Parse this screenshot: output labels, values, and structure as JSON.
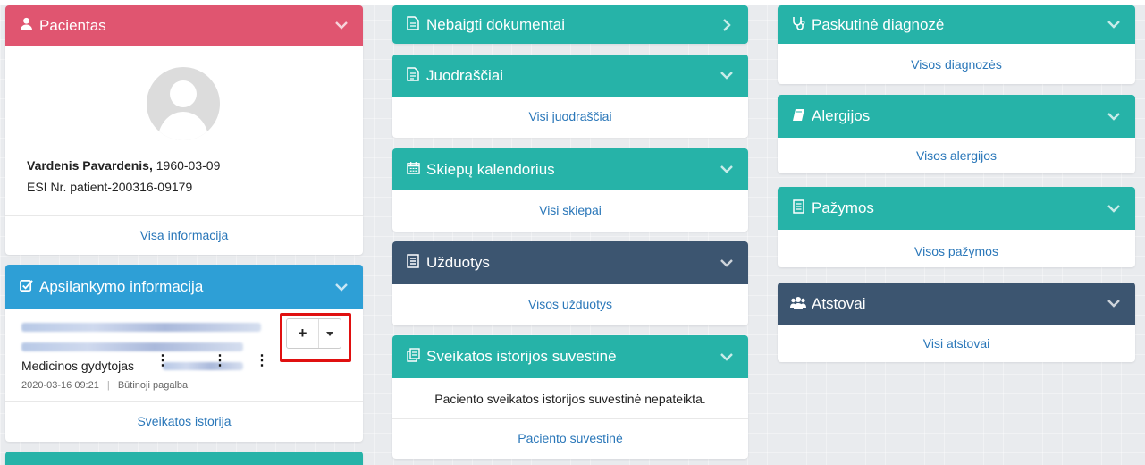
{
  "colors": {
    "teal": "#26b3a8",
    "pink": "#e05570",
    "blue": "#2e9fd6",
    "navy": "#3c5570",
    "link": "#2a77b9",
    "highlight": "#e01010"
  },
  "patient": {
    "title": "Pacientas",
    "icon": "user-icon",
    "name": "Vardenis Pavardenis,",
    "birth_date": "1960-03-09",
    "esi": "ESI Nr. patient-200316-09179",
    "link": "Visa informacija"
  },
  "visit": {
    "title": "Apsilankymo informacija",
    "icon": "checkbox-icon",
    "doctor_label": "Medicinos gydytojas",
    "date": "2020-03-16 09:21",
    "separator": "|",
    "type": "Būtinoji pagalba",
    "add_button": "+",
    "link": "Sveikatos istorija"
  },
  "unfinished": {
    "title": "Nebaigti dokumentai",
    "icon": "document-icon"
  },
  "drafts": {
    "title": "Juodraščiai",
    "icon": "draft-icon",
    "link": "Visi juodraščiai"
  },
  "vaccines": {
    "title": "Skiepų kalendorius",
    "icon": "calendar-icon",
    "link": "Visi skiepai"
  },
  "tasks": {
    "title": "Užduotys",
    "icon": "list-icon",
    "link": "Visos užduotys"
  },
  "summary": {
    "title": "Sveikatos istorijos suvestinė",
    "icon": "copy-icon",
    "message": "Paciento sveikatos istorijos suvestinė nepateikta.",
    "link": "Paciento suvestinė"
  },
  "diagnosis": {
    "title": "Paskutinė diagnozė",
    "icon": "stethoscope-icon",
    "link": "Visos diagnozės"
  },
  "allergies": {
    "title": "Alergijos",
    "icon": "book-icon",
    "link": "Visos alergijos"
  },
  "certificates": {
    "title": "Pažymos",
    "icon": "certificate-icon",
    "link": "Visos pažymos"
  },
  "representatives": {
    "title": "Atstovai",
    "icon": "users-icon",
    "link": "Visi atstovai"
  }
}
